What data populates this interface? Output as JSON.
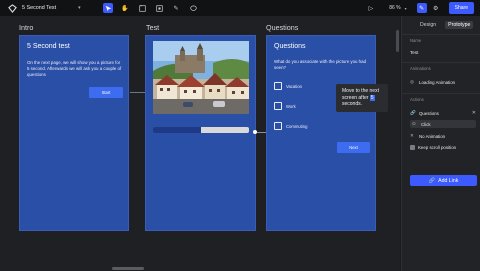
{
  "app": {
    "file_title": "5 Second Test",
    "zoom": "86 %",
    "share_label": "Share",
    "tools": [
      "select-tool",
      "hand-tool",
      "frame-tool",
      "component-tool",
      "pen-tool",
      "comment-tool"
    ]
  },
  "canvas": {
    "frames": [
      {
        "label": "Intro"
      },
      {
        "label": "Test"
      },
      {
        "label": "Questions"
      }
    ],
    "intro": {
      "title": "5 Second test",
      "body": "On the next page, we will show you a picture for 5 second. Afterwards we will ask you a couple of questions",
      "button": "Start"
    },
    "test": {
      "progress": 0.5
    },
    "questions": {
      "title": "Questions",
      "prompt": "What do you associate with the picture you had seen?",
      "options": [
        "Vacation",
        "Work",
        "Commuting"
      ],
      "button": "Next"
    },
    "tooltip": {
      "before": "Move to the next screen after",
      "value": "5",
      "after": "seconds."
    }
  },
  "panel": {
    "tabs": [
      "Design",
      "Prototype"
    ],
    "name_label": "Name",
    "name_value": "Test",
    "animations_label": "Animations",
    "animation_value": "Loading Animation",
    "actions_label": "Actions",
    "action_target": "Questions",
    "trigger": "Click",
    "transition": "No Animation",
    "keep_scroll": "Keep scroll position",
    "add_link": "Add Link"
  },
  "colors": {
    "accent": "#3d5afe",
    "frame_bg": "#2a4fa6",
    "canvas_bg": "#1f2023",
    "panel_bg": "#222326"
  }
}
